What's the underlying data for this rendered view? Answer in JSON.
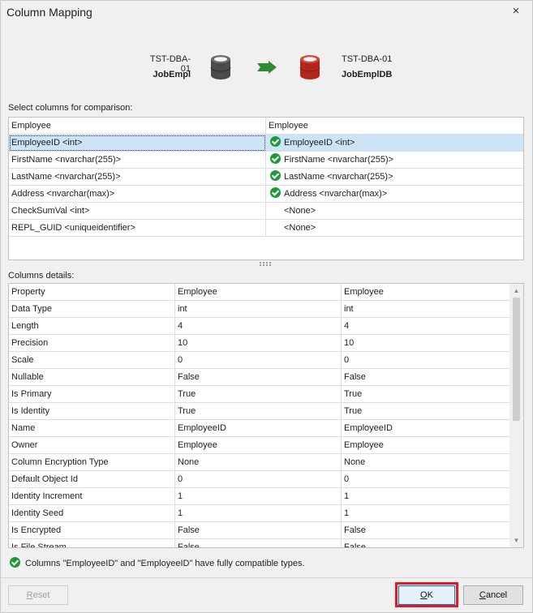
{
  "window": {
    "title": "Column Mapping",
    "close_glyph": "×"
  },
  "source": {
    "server": "TST-DBA-01",
    "database": "JobEmpl"
  },
  "target": {
    "server": "TST-DBA-01",
    "database": "JobEmplDB"
  },
  "icons": {
    "source_db": "database-icon",
    "target_db": "database-icon",
    "direction": "arrow-right-icon",
    "compatible": "check-circle-icon"
  },
  "colors": {
    "source_db": "#4a4a4a",
    "target_db": "#b3261e",
    "arrow": "#2e8b2e",
    "check": "#1f9a3b",
    "selection": "#cce4f7",
    "highlight": "#e01b24"
  },
  "compare": {
    "label": "Select columns for comparison:",
    "headers": [
      "Employee",
      "Employee"
    ],
    "rows": [
      {
        "source": "EmployeeID <int>",
        "target": "EmployeeID <int>",
        "mapped": true,
        "selected": true
      },
      {
        "source": "FirstName <nvarchar(255)>",
        "target": "FirstName <nvarchar(255)>",
        "mapped": true,
        "selected": false
      },
      {
        "source": "LastName <nvarchar(255)>",
        "target": "LastName <nvarchar(255)>",
        "mapped": true,
        "selected": false
      },
      {
        "source": "Address <nvarchar(max)>",
        "target": "Address <nvarchar(max)>",
        "mapped": true,
        "selected": false
      },
      {
        "source": "CheckSumVal <int>",
        "target": "<None>",
        "mapped": false,
        "selected": false
      },
      {
        "source": "REPL_GUID <uniqueidentifier>",
        "target": "<None>",
        "mapped": false,
        "selected": false
      }
    ]
  },
  "details": {
    "label": "Columns details:",
    "headers": [
      "Property",
      "Employee",
      "Employee"
    ],
    "rows": [
      [
        "Data Type",
        "int",
        "int"
      ],
      [
        "Length",
        "4",
        "4"
      ],
      [
        "Precision",
        "10",
        "10"
      ],
      [
        "Scale",
        "0",
        "0"
      ],
      [
        "Nullable",
        "False",
        "False"
      ],
      [
        "Is Primary",
        "True",
        "True"
      ],
      [
        "Is Identity",
        "True",
        "True"
      ],
      [
        "Name",
        "EmployeeID",
        "EmployeeID"
      ],
      [
        "Owner",
        "Employee",
        "Employee"
      ],
      [
        "Column Encryption Type",
        "None",
        "None"
      ],
      [
        "Default Object Id",
        "0",
        "0"
      ],
      [
        "Identity Increment",
        "1",
        "1"
      ],
      [
        "Identity Seed",
        "1",
        "1"
      ],
      [
        "Is Encrypted",
        "False",
        "False"
      ],
      [
        "Is File Stream",
        "False",
        "False"
      ]
    ],
    "scroll": {
      "up_glyph": "▲",
      "down_glyph": "▼"
    }
  },
  "status": {
    "message": "Columns \"EmployeeID\" and \"EmployeeID\" have fully compatible types."
  },
  "buttons": {
    "reset": {
      "first": "R",
      "rest": "eset"
    },
    "ok": {
      "first": "O",
      "rest": "K"
    },
    "cancel": {
      "first": "C",
      "rest": "ancel"
    }
  }
}
